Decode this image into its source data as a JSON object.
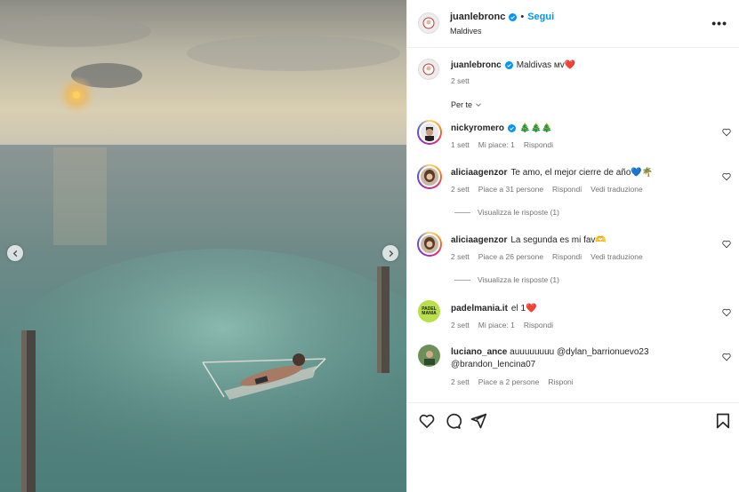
{
  "post": {
    "author": "juanlebronc",
    "follow_label": "Segui",
    "dot": "•",
    "location": "Maldives",
    "more_label": "•••"
  },
  "caption": {
    "author": "juanlebronc",
    "text": "Maldivas ᴍᴠ❤️",
    "time": "2 sett"
  },
  "sort_label": "Per te",
  "comments": [
    {
      "author": "nickyromero",
      "text": "🎄🎄🎄",
      "time": "1 sett",
      "likes": "Mi piace: 1",
      "reply": "Rispondi"
    },
    {
      "author": "aliciaagenzor",
      "text": "Te amo, el mejor cierre de año💙🌴",
      "time": "2 sett",
      "likes": "Piace a 31 persone",
      "reply": "Rispondi",
      "translate": "Vedi traduzione",
      "replies": "Visualizza le risposte (1)"
    },
    {
      "author": "aliciaagenzor",
      "text": "La segunda es mi fav🫶",
      "time": "2 sett",
      "likes": "Piace a 26 persone",
      "reply": "Rispondi",
      "translate": "Vedi traduzione",
      "replies": "Visualizza le risposte (1)"
    },
    {
      "author": "padelmania.it",
      "text": "el 1❤️",
      "time": "2 sett",
      "likes": "Mi piace: 1",
      "reply": "Rispondi",
      "avatar_text": "PADEL MANIA"
    },
    {
      "author": "luciano_ance",
      "text": "auuuuuuuu",
      "mention1": "@dylan_barrionuevo23",
      "mention2": "@brandon_lencina07",
      "time": "2 sett",
      "likes": "Piace a 2 persone",
      "reply": "Risponi"
    }
  ],
  "colors": {
    "accent": "#0095f6",
    "verified": "#0095f6",
    "muted": "#737373",
    "heart": "#ed4956"
  },
  "icons": [
    "heart-icon",
    "comment-icon",
    "share-icon",
    "bookmark-icon",
    "chevron-left-icon",
    "chevron-right-icon",
    "more-icon",
    "verified-icon"
  ]
}
